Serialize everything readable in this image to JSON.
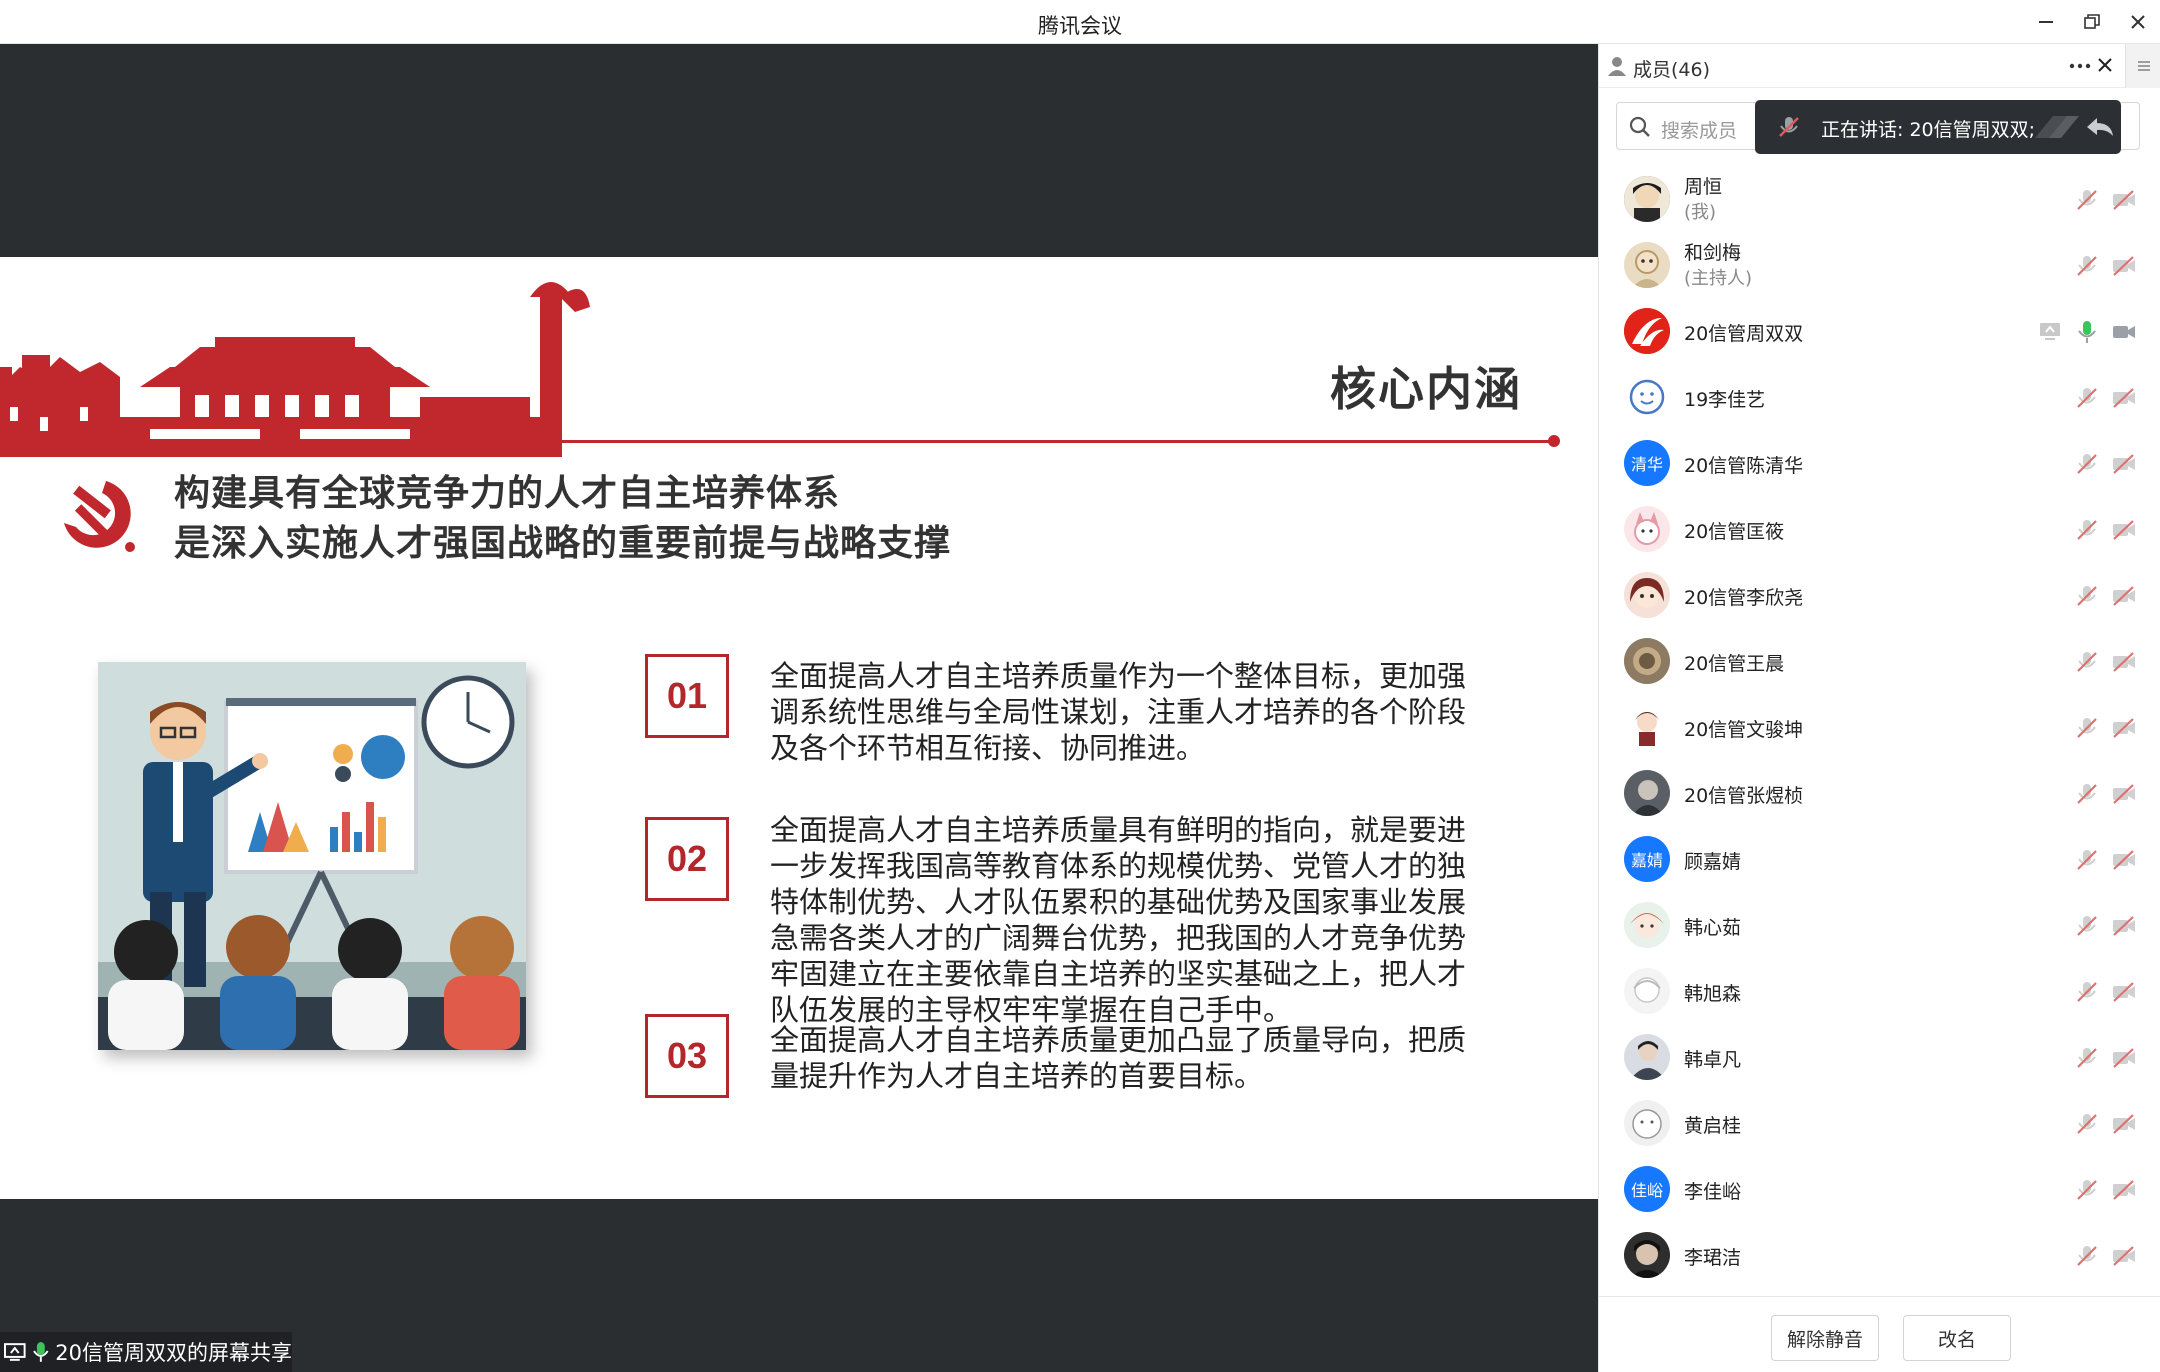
{
  "window": {
    "title": "腾讯会议"
  },
  "slide": {
    "title": "核心内涵",
    "headline": [
      "构建具有全球竞争力的人才自主培养体系",
      "是深入实施人才强国战略的重要前提与战略支撑"
    ],
    "items": [
      {
        "num": "01",
        "lines": [
          "全面提高人才自主培养质量作为一个整体目标，更加强",
          "调系统性思维与全局性谋划，注重人才培养的各个阶段",
          "及各个环节相互衔接、协同推进。"
        ]
      },
      {
        "num": "02",
        "lines": [
          "全面提高人才自主培养质量具有鲜明的指向，就是要进",
          "一步发挥我国高等教育体系的规模优势、党管人才的独",
          "特体制优势、人才队伍累积的基础优势及国家事业发展",
          "急需各类人才的广阔舞台优势，把我国的人才竞争优势",
          "牢固建立在主要依靠自主培养的坚实基础之上，把人才",
          "队伍发展的主导权牢牢掌握在自己手中。"
        ]
      },
      {
        "num": "03",
        "lines": [
          "全面提高人才自主培养质量更加凸显了质量导向，把质",
          "量提升作为人才自主培养的首要目标。"
        ]
      }
    ]
  },
  "share_status": {
    "label": "20信管周双双的屏幕共享"
  },
  "panel": {
    "members_label": "成员(46)",
    "search_placeholder": "搜索成员",
    "speaking": "正在讲话: 20信管周双双;",
    "members": [
      {
        "name": "周恒",
        "role": "(我)",
        "avatar": "photo",
        "color": "#4a4a4a"
      },
      {
        "name": "和剑梅",
        "role": "(主持人)",
        "avatar": "photo",
        "color": "#c9b48c"
      },
      {
        "name": "20信管周双双",
        "role": "",
        "avatar": "logo",
        "color": "#e2231a",
        "active": true
      },
      {
        "name": "19李佳艺",
        "role": "",
        "avatar": "face",
        "color": "#ffffff"
      },
      {
        "name": "20信管陈清华",
        "role": "",
        "avatar": "text",
        "text": "清华",
        "color": "#1677ff"
      },
      {
        "name": "20信管匡筱",
        "role": "",
        "avatar": "photo",
        "color": "#f1c9d0"
      },
      {
        "name": "20信管李欣尧",
        "role": "",
        "avatar": "photo",
        "color": "#b04a3a"
      },
      {
        "name": "20信管王晨",
        "role": "",
        "avatar": "photo",
        "color": "#8c7a62"
      },
      {
        "name": "20信管文骏坤",
        "role": "",
        "avatar": "photo",
        "color": "#e9d6c5"
      },
      {
        "name": "20信管张煜桢",
        "role": "",
        "avatar": "photo",
        "color": "#5a5f66"
      },
      {
        "name": "顾嘉婧",
        "role": "",
        "avatar": "text",
        "text": "嘉婧",
        "color": "#1677ff"
      },
      {
        "name": "韩心茹",
        "role": "",
        "avatar": "photo",
        "color": "#cfe3d8"
      },
      {
        "name": "韩旭森",
        "role": "",
        "avatar": "photo",
        "color": "#eeeeee"
      },
      {
        "name": "韩卓凡",
        "role": "",
        "avatar": "photo",
        "color": "#6b7380"
      },
      {
        "name": "黄启桂",
        "role": "",
        "avatar": "photo",
        "color": "#e5e5e5"
      },
      {
        "name": "李佳峪",
        "role": "",
        "avatar": "text",
        "text": "佳峪",
        "color": "#1677ff"
      },
      {
        "name": "李珺洁",
        "role": "",
        "avatar": "photo",
        "color": "#2e2e2e"
      }
    ],
    "buttons": {
      "unmute": "解除静音",
      "rename": "改名"
    }
  },
  "colors": {
    "accent_red": "#c0282d",
    "muted_icon": "#e07070",
    "mic_active": "#3ac55a",
    "share_bg": "#2b2e31"
  }
}
